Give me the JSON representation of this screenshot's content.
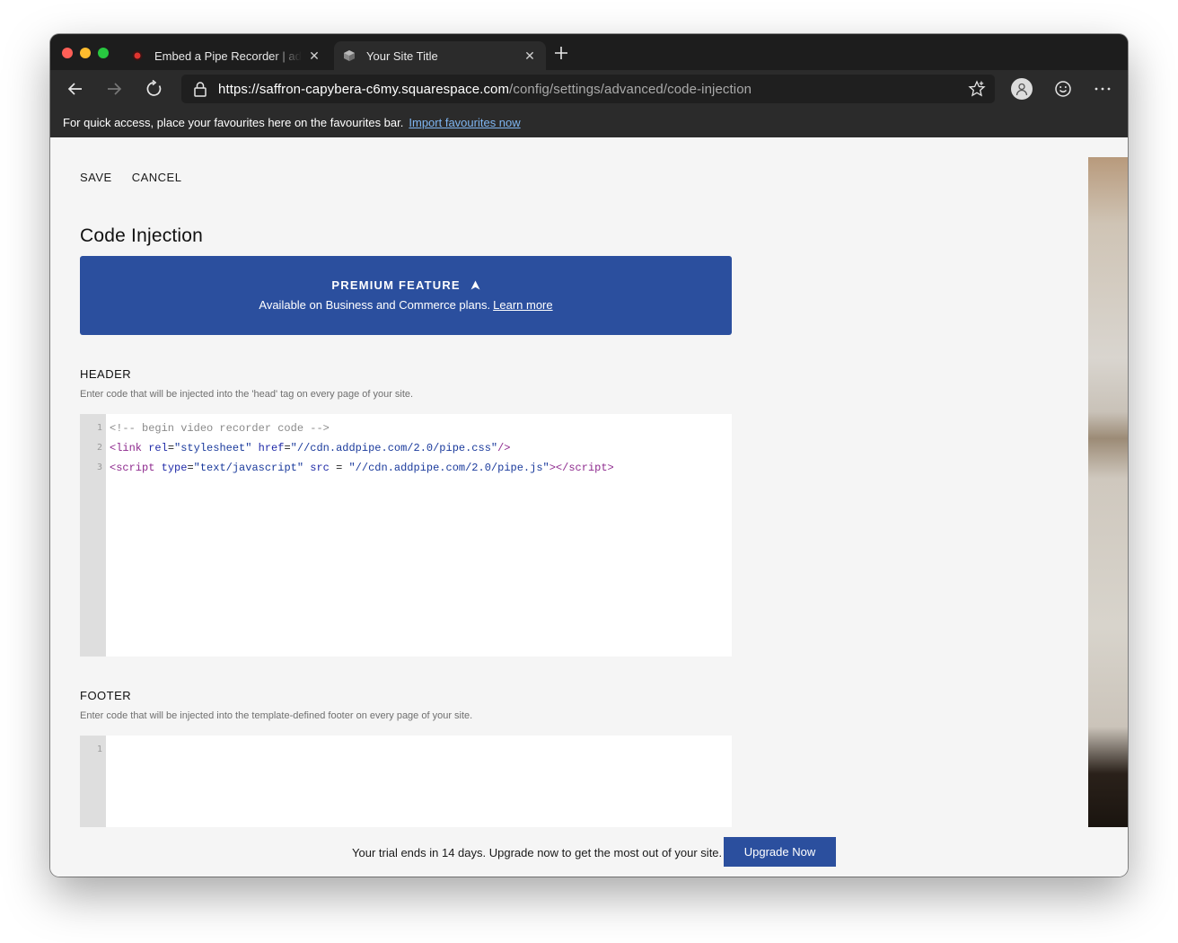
{
  "browser": {
    "tabs": [
      {
        "title": "Embed a Pipe Recorder | addpipe",
        "active": false
      },
      {
        "title": "Your Site Title",
        "active": true
      }
    ],
    "url_host": "https://saffron-capybera-c6my.squarespace.com",
    "url_path": "/config/settings/advanced/code-injection",
    "favourites_text": "For quick access, place your favourites here on the favourites bar.",
    "favourites_link": "Import favourites now",
    "colors": {
      "tab_strip": "#1d1d1d",
      "toolbar": "#2b2b2b",
      "link": "#7fb6f2"
    }
  },
  "page": {
    "actions": {
      "save": "SAVE",
      "cancel": "CANCEL"
    },
    "title": "Code Injection",
    "premium": {
      "title": "PREMIUM FEATURE",
      "subtitle": "Available on Business and Commerce plans.",
      "link": "Learn more",
      "color": "#2b4f9e"
    },
    "header": {
      "label": "HEADER",
      "description": "Enter code that will be injected into the 'head' tag on every page of your site.",
      "line_numbers": [
        "1",
        "2",
        "3"
      ]
    },
    "footer": {
      "label": "FOOTER",
      "description": "Enter code that will be injected into the template-defined footer on every page of your site.",
      "line_numbers": [
        "1"
      ]
    },
    "trial": {
      "text": "Your trial ends in 14 days. Upgrade now to get the most out of your site.",
      "button": "Upgrade Now"
    }
  }
}
